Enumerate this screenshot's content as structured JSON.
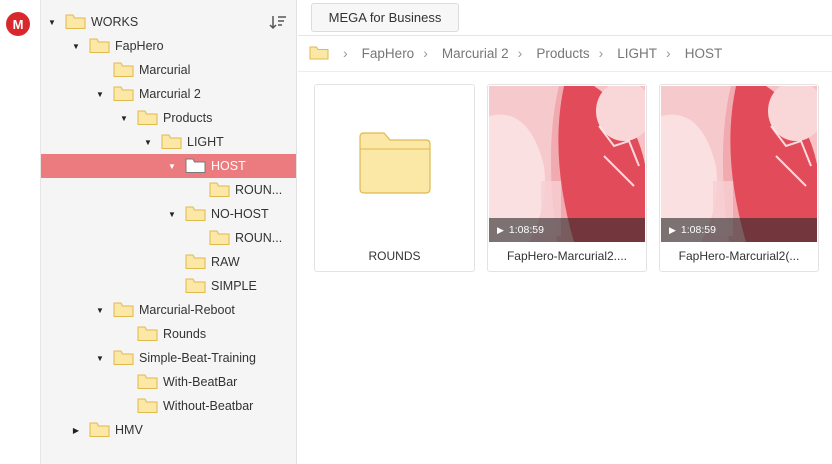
{
  "app": {
    "logo_letter": "M"
  },
  "tree": {
    "items": [
      {
        "label": "WORKS",
        "level": 0,
        "arrow": "down",
        "selected": false
      },
      {
        "label": "FapHero",
        "level": 1,
        "arrow": "down",
        "selected": false
      },
      {
        "label": "Marcurial",
        "level": 2,
        "arrow": "none",
        "selected": false
      },
      {
        "label": "Marcurial 2",
        "level": 2,
        "arrow": "down",
        "selected": false
      },
      {
        "label": "Products",
        "level": 3,
        "arrow": "down",
        "selected": false
      },
      {
        "label": "LIGHT",
        "level": 4,
        "arrow": "down",
        "selected": false
      },
      {
        "label": "HOST",
        "level": 5,
        "arrow": "down",
        "selected": true
      },
      {
        "label": "ROUN...",
        "level": 6,
        "arrow": "none",
        "selected": false
      },
      {
        "label": "NO-HOST",
        "level": 5,
        "arrow": "down",
        "selected": false
      },
      {
        "label": "ROUN...",
        "level": 6,
        "arrow": "none",
        "selected": false
      },
      {
        "label": "RAW",
        "level": 5,
        "arrow": "none",
        "selected": false
      },
      {
        "label": "SIMPLE",
        "level": 5,
        "arrow": "none",
        "selected": false
      },
      {
        "label": "Marcurial-Reboot",
        "level": 2,
        "arrow": "down",
        "selected": false
      },
      {
        "label": "Rounds",
        "level": 3,
        "arrow": "none",
        "selected": false
      },
      {
        "label": "Simple-Beat-Training",
        "level": 2,
        "arrow": "down",
        "selected": false
      },
      {
        "label": "With-BeatBar",
        "level": 3,
        "arrow": "none",
        "selected": false
      },
      {
        "label": "Without-Beatbar",
        "level": 3,
        "arrow": "none",
        "selected": false
      },
      {
        "label": "HMV",
        "level": 1,
        "arrow": "right",
        "selected": false
      }
    ]
  },
  "toolbar": {
    "business_button": "MEGA for Business"
  },
  "breadcrumb": [
    "FapHero",
    "Marcurial 2",
    "Products",
    "LIGHT",
    "HOST"
  ],
  "grid": [
    {
      "type": "folder",
      "name": "ROUNDS"
    },
    {
      "type": "video",
      "name": "FapHero-Marcurial2....",
      "duration": "1:08:59"
    },
    {
      "type": "video",
      "name": "FapHero-Marcurial2(...",
      "duration": "1:08:59"
    }
  ],
  "colors": {
    "brand": "#d9272e",
    "selected_row": "#ec7b7f",
    "folder": "#fbe7a6",
    "folder_stroke": "#e0b94f"
  }
}
